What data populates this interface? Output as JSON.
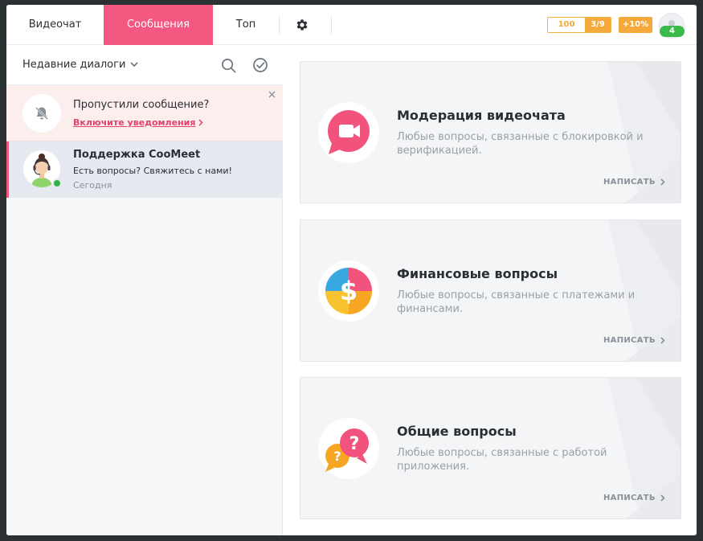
{
  "header": {
    "tabs": [
      {
        "label": "Видеочат",
        "active": false
      },
      {
        "label": "Сообщения",
        "active": true
      },
      {
        "label": "Топ",
        "active": false
      }
    ],
    "coins": "100",
    "level": "3/9",
    "bonus": "+10%",
    "user_badge": "4",
    "accent_color": "#f4577f",
    "badge_color": "#f4a93a",
    "settings_icon": "gear-icon"
  },
  "sidebar": {
    "filter_label": "Недавние диалоги",
    "search_icon": "search-icon",
    "mark_read_icon": "check-circle-icon",
    "notification": {
      "title": "Пропустили сообщение?",
      "link": "Включите уведомления",
      "icon": "bell-off-icon"
    },
    "dialogs": [
      {
        "name": "Поддержка CooMeet",
        "preview": "Есть вопросы? Свяжитесь с нами!",
        "time": "Сегодня",
        "online": true
      }
    ]
  },
  "main": {
    "cards": [
      {
        "title": "Модерация видеочата",
        "description": "Любые вопросы, связанные с блокировкой и верификацией.",
        "action": "НАПИСАТЬ",
        "icon": "video-camera-icon"
      },
      {
        "title": "Финансовые вопросы",
        "description": "Любые вопросы, связанные с платежами и финансами.",
        "action": "НАПИСАТЬ",
        "icon": "dollar-icon"
      },
      {
        "title": "Общие вопросы",
        "description": "Любые вопросы, связанные с работой приложения.",
        "action": "НАПИСАТЬ",
        "icon": "question-icon"
      }
    ]
  }
}
